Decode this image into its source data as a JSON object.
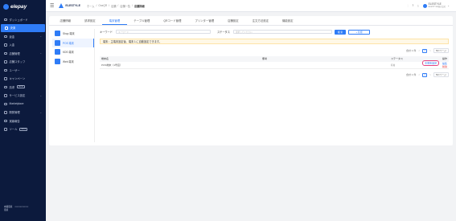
{
  "sidebar": {
    "logo": "elepay",
    "items": [
      {
        "label": "ダッシュボード",
        "icon": "dashboard-icon",
        "active": false,
        "arrow": false
      },
      {
        "label": "決済",
        "icon": "payment-icon",
        "active": true,
        "arrow": false
      },
      {
        "label": "返金",
        "icon": "refund-icon",
        "active": false,
        "arrow": true
      },
      {
        "label": "入金",
        "icon": "deposit-icon",
        "active": false,
        "arrow": false
      },
      {
        "label": "店舗管理",
        "icon": "store-icon",
        "active": false,
        "arrow": true
      },
      {
        "label": "店舗スタッフ",
        "icon": "staff-icon",
        "active": false,
        "arrow": false
      },
      {
        "label": "ユーザー",
        "icon": "user-icon",
        "active": false,
        "arrow": false
      },
      {
        "label": "キャンペーン",
        "icon": "campaign-icon",
        "active": false,
        "arrow": false
      },
      {
        "label": "請求",
        "icon": "invoice-icon",
        "active": false,
        "arrow": false,
        "badge": "BETA"
      },
      {
        "label": "サービス設定",
        "icon": "settings-icon",
        "active": false,
        "arrow": true
      },
      {
        "label": "Marketplace",
        "icon": "marketplace-icon",
        "active": false,
        "arrow": false
      },
      {
        "label": "開発管理",
        "icon": "developer-icon",
        "active": false,
        "arrow": true
      },
      {
        "label": "実績報告",
        "icon": "report-icon",
        "active": false,
        "arrow": false
      },
      {
        "label": "ツール",
        "icon": "tool-icon",
        "active": false,
        "arrow": false,
        "badge": "BETA"
      }
    ],
    "footer": {
      "label1": "本番環境",
      "label2": "環境",
      "value": "xxxxxxxxxxxxx"
    }
  },
  "topbar": {
    "brand": "ELESTYLE",
    "breadcrumbs": [
      "ホーム",
      "OneQR",
      "店舗",
      "店舗一覧"
    ],
    "current": "店舗詳細",
    "user_name": "ELESTYLE",
    "user_sub": "ELESTYLE株式会社"
  },
  "tabs": [
    {
      "label": "店舗情報",
      "active": false
    },
    {
      "label": "請求設定",
      "active": false
    },
    {
      "label": "端末管理",
      "active": true
    },
    {
      "label": "テーブル管理",
      "active": false
    },
    {
      "label": "QRコード管理",
      "active": false
    },
    {
      "label": "プリンター管理",
      "active": false
    },
    {
      "label": "店舗設定",
      "active": false
    },
    {
      "label": "注文方法設定",
      "active": false
    },
    {
      "label": "機能設定",
      "active": false
    }
  ],
  "methods": [
    {
      "label": "Shop 端末",
      "active": false
    },
    {
      "label": "POS 端末",
      "active": true
    },
    {
      "label": "KDS 端末",
      "active": false
    },
    {
      "label": "Web 端末",
      "active": false
    }
  ],
  "filter": {
    "keyword_label": "キーワード",
    "keyword_placeholder": "キーワード",
    "status_label": "ステータス",
    "status_placeholder": "選択してください",
    "search_label": "検 索",
    "add_label": "+ 新規"
  },
  "notice": "端末：主端末設定後、端末１に自動設定できます。",
  "pager": {
    "total": "合計 1 件",
    "prev": "<",
    "page": "1",
    "next": ">",
    "size": "50/ページ"
  },
  "table": {
    "headers": [
      "端末名",
      "備考",
      "ステータス",
      "操作"
    ],
    "rows": [
      {
        "name": "POS端末（1号店）",
        "note": "",
        "status": "有効",
        "primary": "主端末設定",
        "edit": "編集",
        "delete": "削除"
      }
    ]
  }
}
